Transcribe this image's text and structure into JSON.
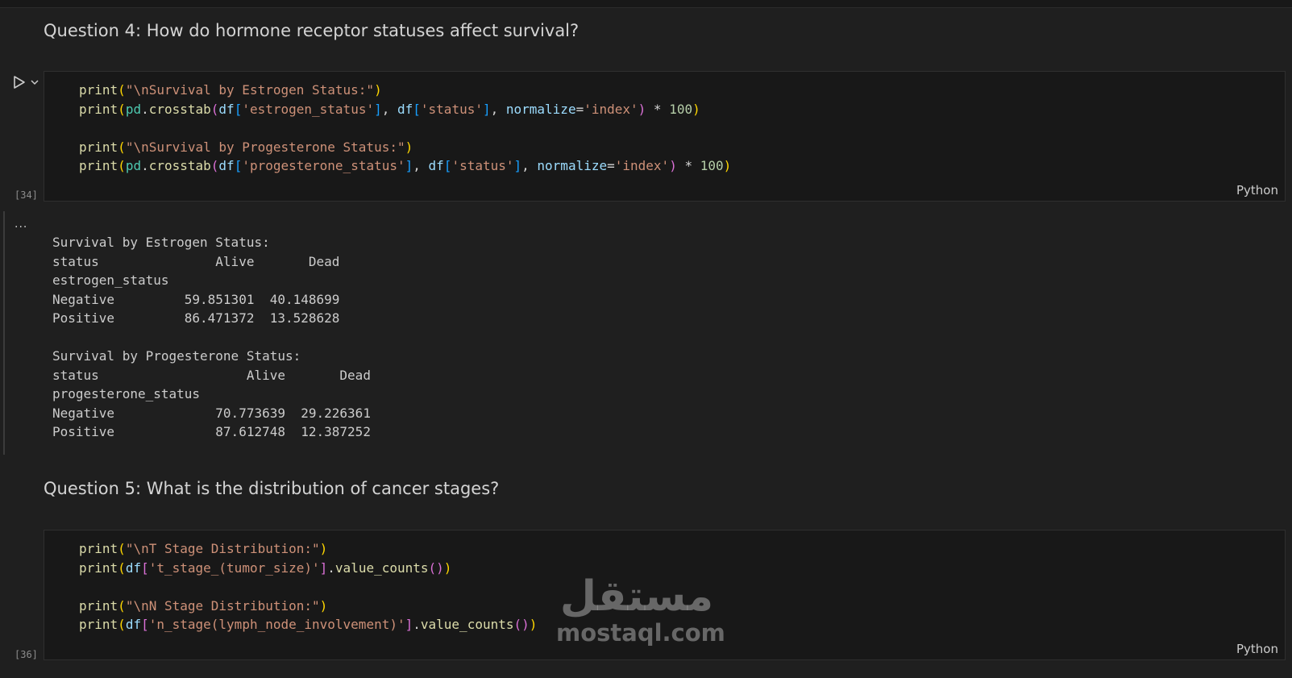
{
  "notebook": {
    "q4": {
      "heading": "Question 4: How do hormone receptor statuses affect survival?",
      "exec_count": "[34]",
      "language": "Python",
      "code": {
        "print": "print",
        "pd": "pd",
        "crosstab": "crosstab",
        "df": "df",
        "normalize": "normalize",
        "str_est_title": "\"\\nSurvival by Estrogen Status:\"",
        "str_prog_title": "\"\\nSurvival by Progesterone Status:\"",
        "str_estrogen": "'estrogen_status'",
        "str_progesterone": "'progesterone_status'",
        "str_status": "'status'",
        "str_index": "'index'",
        "num_100": "100"
      },
      "output": {
        "more": "...",
        "lines": [
          "Survival by Estrogen Status:",
          "status               Alive       Dead",
          "estrogen_status",
          "Negative         59.851301  40.148699",
          "Positive         86.471372  13.528628",
          "",
          "Survival by Progesterone Status:",
          "status                   Alive       Dead",
          "progesterone_status",
          "Negative             70.773639  29.226361",
          "Positive             87.612748  12.387252"
        ]
      }
    },
    "q5": {
      "heading": "Question 5: What is the distribution of cancer stages?",
      "exec_count": "[36]",
      "language": "Python",
      "code": {
        "print": "print",
        "df": "df",
        "value_counts": "value_counts",
        "str_t_title": "\"\\nT Stage Distribution:\"",
        "str_n_title": "\"\\nN Stage Distribution:\"",
        "str_t_col": "'t_stage_(tumor_size)'",
        "str_n_col": "'n_stage(lymph_node_involvement)'"
      }
    },
    "watermark": {
      "arabic": "مستقل",
      "latin": "mostaql.com"
    }
  },
  "colors": {
    "background": "#1f1f1f",
    "cell_background": "#181818",
    "function": "#dcdcaa",
    "string": "#ce9178",
    "variable": "#9cdcfe",
    "module": "#4ec9b0",
    "number": "#b5cea8"
  }
}
